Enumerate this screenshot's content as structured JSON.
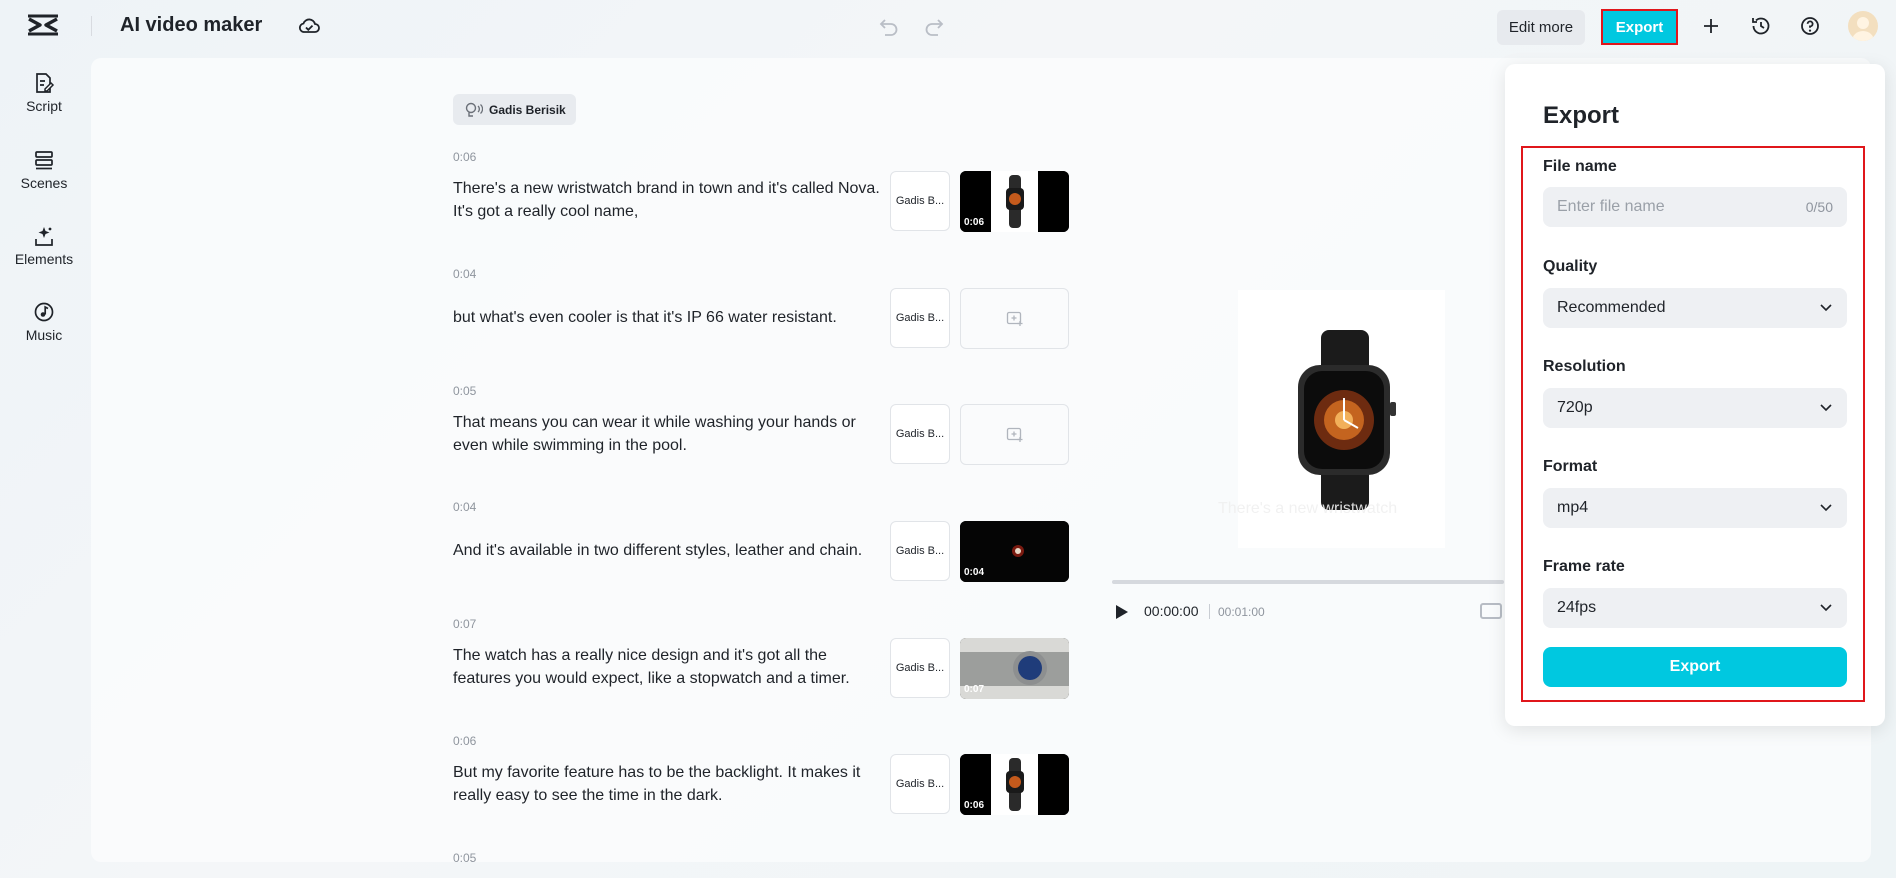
{
  "header": {
    "app_title": "AI video maker",
    "edit_more_label": "Edit more",
    "export_label": "Export"
  },
  "sidebar": {
    "items": [
      {
        "label": "Script",
        "icon": "script-icon"
      },
      {
        "label": "Scenes",
        "icon": "scenes-icon"
      },
      {
        "label": "Elements",
        "icon": "elements-icon"
      },
      {
        "label": "Music",
        "icon": "music-icon"
      }
    ]
  },
  "script": {
    "voice_label": "Gadis Berisik",
    "scenes": [
      {
        "time": "0:06",
        "text": "There's a new wristwatch brand in town and it's called Nova. It's got a really cool name,",
        "voice": "Gadis B...",
        "thumb_duration": "0:06"
      },
      {
        "time": "0:04",
        "text": "but what's even cooler is that it's IP 66 water resistant.",
        "voice": "Gadis B...",
        "thumb_duration": ""
      },
      {
        "time": "0:05",
        "text": "That means you can wear it while washing your hands or even while swimming in the pool.",
        "voice": "Gadis B...",
        "thumb_duration": ""
      },
      {
        "time": "0:04",
        "text": "And it's available in two different styles, leather and chain.",
        "voice": "Gadis B...",
        "thumb_duration": "0:04"
      },
      {
        "time": "0:07",
        "text": "The watch has a really nice design and it's got all the features you would expect, like a stopwatch and a timer.",
        "voice": "Gadis B...",
        "thumb_duration": "0:07"
      },
      {
        "time": "0:06",
        "text": "But my favorite feature has to be the backlight. It makes it really easy to see the time in the dark.",
        "voice": "Gadis B...",
        "thumb_duration": "0:06"
      },
      {
        "time": "0:05",
        "text": "",
        "voice": "",
        "thumb_duration": ""
      }
    ]
  },
  "player": {
    "caption": "There's a new wristwatch",
    "current_time": "00:00:00",
    "total_time": "00:01:00"
  },
  "export_panel": {
    "title": "Export",
    "file_name_label": "File name",
    "file_name_placeholder": "Enter file name",
    "file_name_count": "0/50",
    "quality_label": "Quality",
    "quality_value": "Recommended",
    "resolution_label": "Resolution",
    "resolution_value": "720p",
    "format_label": "Format",
    "format_value": "mp4",
    "frame_rate_label": "Frame rate",
    "frame_rate_value": "24fps",
    "export_button_label": "Export"
  },
  "colors": {
    "accent": "#00c8e0",
    "highlight_border": "#e0161b"
  }
}
